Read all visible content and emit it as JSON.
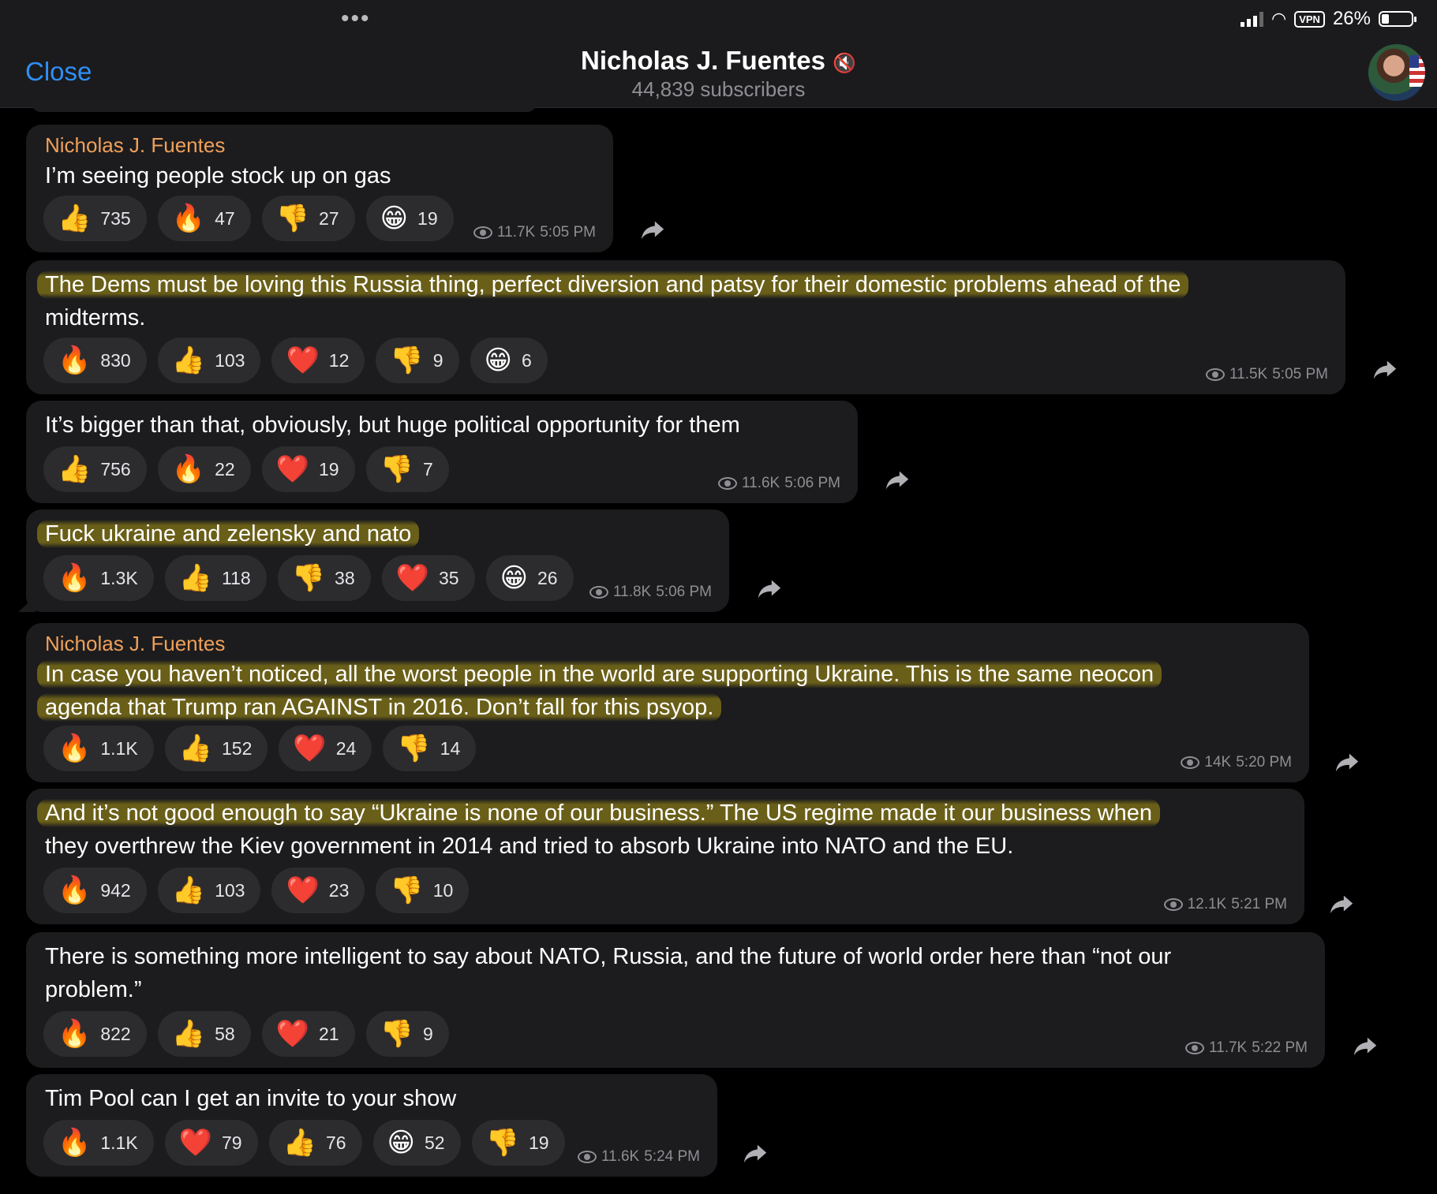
{
  "header": {
    "close_label": "Close",
    "title": "Nicholas J. Fuentes",
    "subtitle": "44,839 subscribers",
    "battery": "26%",
    "vpn": "VPN"
  },
  "icons": {
    "mute": "speaker-muted-icon",
    "views": "eye-icon",
    "share": "share-arrow-icon",
    "reaction_types": [
      "thumbs-up",
      "fire",
      "thumbs-down",
      "grin",
      "heart"
    ]
  },
  "messages": [
    {
      "author": "Nicholas J. Fuentes",
      "lines": [
        "I’m seeing people stock up on gas"
      ],
      "reactions": [
        {
          "emoji": "👍",
          "count": "735"
        },
        {
          "emoji": "🔥",
          "count": "47"
        },
        {
          "emoji": "👎",
          "count": "27"
        },
        {
          "emoji": "😁",
          "count": "19"
        }
      ],
      "views": "11.7K",
      "time": "5:05 PM"
    },
    {
      "author": "",
      "lines": [
        "The Dems must be loving this Russia thing, perfect diversion and patsy for their domestic problems ahead of the",
        "midterms."
      ],
      "reactions": [
        {
          "emoji": "🔥",
          "count": "830"
        },
        {
          "emoji": "👍",
          "count": "103"
        },
        {
          "emoji": "❤️",
          "count": "12"
        },
        {
          "emoji": "👎",
          "count": "9"
        },
        {
          "emoji": "😁",
          "count": "6"
        }
      ],
      "views": "11.5K",
      "time": "5:05 PM"
    },
    {
      "author": "",
      "lines": [
        "It’s bigger than that, obviously, but huge political opportunity for them"
      ],
      "reactions": [
        {
          "emoji": "👍",
          "count": "756"
        },
        {
          "emoji": "🔥",
          "count": "22"
        },
        {
          "emoji": "❤️",
          "count": "19"
        },
        {
          "emoji": "👎",
          "count": "7"
        }
      ],
      "views": "11.6K",
      "time": "5:06 PM"
    },
    {
      "author": "",
      "lines": [
        "Fuck ukraine and zelensky and nato"
      ],
      "reactions": [
        {
          "emoji": "🔥",
          "count": "1.3K"
        },
        {
          "emoji": "👍",
          "count": "118"
        },
        {
          "emoji": "👎",
          "count": "38"
        },
        {
          "emoji": "❤️",
          "count": "35"
        },
        {
          "emoji": "😁",
          "count": "26"
        }
      ],
      "views": "11.8K",
      "time": "5:06 PM"
    },
    {
      "author": "Nicholas J. Fuentes",
      "lines": [
        "In case you haven’t noticed, all the worst people in the world are supporting Ukraine. This is the same neocon",
        "agenda that Trump ran AGAINST in 2016. Don’t fall for this psyop."
      ],
      "reactions": [
        {
          "emoji": "🔥",
          "count": "1.1K"
        },
        {
          "emoji": "👍",
          "count": "152"
        },
        {
          "emoji": "❤️",
          "count": "24"
        },
        {
          "emoji": "👎",
          "count": "14"
        }
      ],
      "views": "14K",
      "time": "5:20 PM"
    },
    {
      "author": "",
      "lines": [
        "And it’s not good enough to say “Ukraine is none of our business.” The US regime made it our business when",
        "they overthrew the Kiev government in 2014 and tried to absorb Ukraine into NATO and the EU."
      ],
      "reactions": [
        {
          "emoji": "🔥",
          "count": "942"
        },
        {
          "emoji": "👍",
          "count": "103"
        },
        {
          "emoji": "❤️",
          "count": "23"
        },
        {
          "emoji": "👎",
          "count": "10"
        }
      ],
      "views": "12.1K",
      "time": "5:21 PM"
    },
    {
      "author": "",
      "lines": [
        "There is something more intelligent to say about NATO, Russia, and the future of world order here than “not our",
        "problem.”"
      ],
      "reactions": [
        {
          "emoji": "🔥",
          "count": "822"
        },
        {
          "emoji": "👍",
          "count": "58"
        },
        {
          "emoji": "❤️",
          "count": "21"
        },
        {
          "emoji": "👎",
          "count": "9"
        }
      ],
      "views": "11.7K",
      "time": "5:22 PM"
    },
    {
      "author": "",
      "lines": [
        "Tim Pool can I get an invite to your show"
      ],
      "reactions": [
        {
          "emoji": "🔥",
          "count": "1.1K"
        },
        {
          "emoji": "❤️",
          "count": "79"
        },
        {
          "emoji": "👍",
          "count": "76"
        },
        {
          "emoji": "😁",
          "count": "52"
        },
        {
          "emoji": "👎",
          "count": "19"
        }
      ],
      "views": "11.6K",
      "time": "5:24 PM"
    }
  ]
}
